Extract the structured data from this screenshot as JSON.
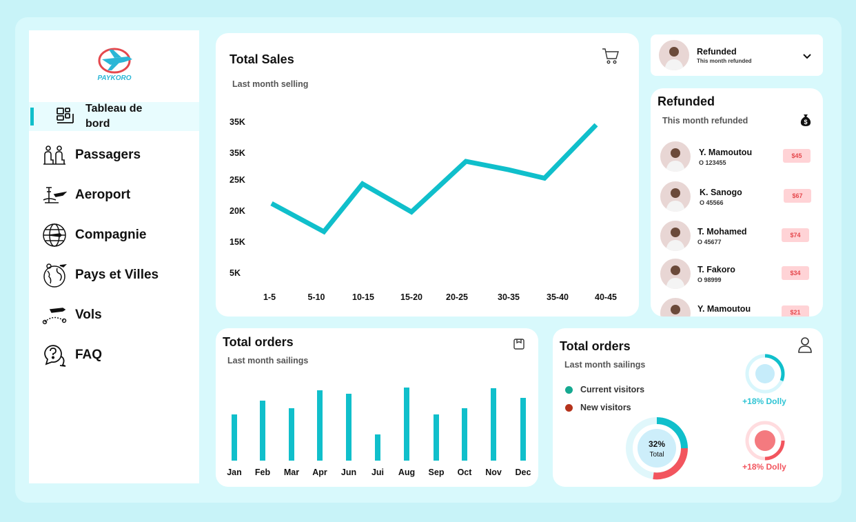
{
  "app": {
    "logo_text": "PAYKORO"
  },
  "sidebar": {
    "items": [
      {
        "label": "Tableau de bord",
        "icon": "dashboard-icon",
        "active": true
      },
      {
        "label": "Passagers",
        "icon": "passengers-icon"
      },
      {
        "label": "Aeroport",
        "icon": "airport-icon"
      },
      {
        "label": "Compagnie",
        "icon": "globe-plane-icon"
      },
      {
        "label": "Pays et Villes",
        "icon": "world-map-icon"
      },
      {
        "label": "Vols",
        "icon": "flight-route-icon"
      },
      {
        "label": "FAQ",
        "icon": "help-chat-icon"
      }
    ]
  },
  "sales": {
    "title": "Total Sales",
    "subtitle": "Last month selling",
    "icon": "cart-icon"
  },
  "refund_select": {
    "label": "Refunded",
    "sub": "This month refunded",
    "icon": "chevron-down-icon"
  },
  "refunded": {
    "title": "Refunded",
    "subtitle": "This month refunded",
    "icon": "money-bag-icon",
    "people": [
      {
        "name": "Y. Mamoutou",
        "id": "O 123455",
        "amount": "$45"
      },
      {
        "name": "K. Sanogo",
        "id": "O 45566",
        "amount": "$67"
      },
      {
        "name": "T. Mohamed",
        "id": "O 45677",
        "amount": "$74"
      },
      {
        "name": "T. Fakoro",
        "id": "O 98999",
        "amount": "$34"
      },
      {
        "name": "Y. Mamoutou",
        "id": "",
        "amount": "$21"
      }
    ]
  },
  "orders_bar": {
    "title": "Total orders",
    "subtitle": "Last month sailings",
    "icon": "box-icon"
  },
  "orders_donut": {
    "title": "Total orders",
    "subtitle": "Last month sailings",
    "icon": "user-icon",
    "legend": [
      {
        "label": "Current visitors",
        "color": "#16a991"
      },
      {
        "label": "New visitors",
        "color": "#b5331c"
      }
    ],
    "center_value": "32%",
    "center_label": "Total",
    "mini1_label": "+18% Dolly",
    "mini2_label": "+18% Dolly"
  },
  "colors": {
    "accent": "#10bfcb",
    "accent_light": "#d3f5fb",
    "red": "#f2555e",
    "red_light": "#ffd3d6"
  },
  "chart_data": [
    {
      "type": "line",
      "title": "Total Sales",
      "categories": [
        "1-5",
        "5-10",
        "10-15",
        "15-20",
        "20-25",
        "30-35",
        "35-40",
        "40-45"
      ],
      "y_tick_labels": [
        "35K",
        "35K",
        "25K",
        "20K",
        "15K",
        "5K"
      ],
      "values": [
        21,
        16,
        24.5,
        19.5,
        28.5,
        27,
        25.5,
        35
      ]
    },
    {
      "type": "bar",
      "title": "Total orders",
      "categories": [
        "Jan",
        "Feb",
        "Mar",
        "Apr",
        "Jun",
        "Jui",
        "Aug",
        "Sep",
        "Oct",
        "Nov",
        "Dec"
      ],
      "values": [
        67,
        87,
        76,
        102,
        97,
        38,
        106,
        67,
        76,
        105,
        91
      ]
    },
    {
      "type": "pie",
      "title": "Total orders",
      "center": "32%",
      "series": [
        {
          "name": "Current visitors",
          "values": [
            32
          ]
        },
        {
          "name": "New visitors",
          "values": [
            28
          ]
        }
      ]
    }
  ]
}
